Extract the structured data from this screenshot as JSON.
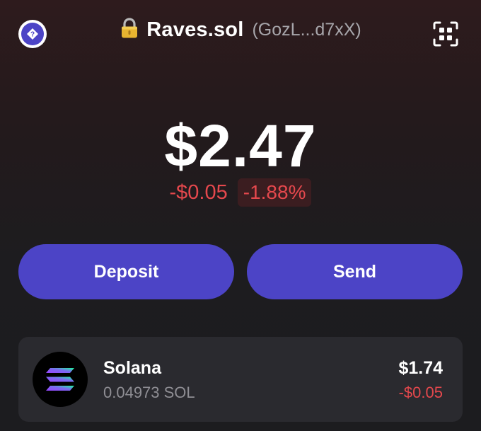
{
  "header": {
    "help_icon": "question-icon",
    "lock_icon": "lock-icon",
    "account_name": "Raves.sol",
    "account_address": "(GozL...d7xX)",
    "scan_icon": "qr-scan-icon"
  },
  "balance": {
    "total": "$2.47",
    "change_abs": "-$0.05",
    "change_pct": "-1.88%"
  },
  "actions": {
    "deposit_label": "Deposit",
    "send_label": "Send"
  },
  "tokens": [
    {
      "icon": "solana-logo-icon",
      "name": "Solana",
      "amount": "0.04973 SOL",
      "value": "$1.74",
      "change": "-$0.05"
    }
  ],
  "colors": {
    "accent": "#4c44c6",
    "negative": "#e5484d",
    "negative_bg": "#3b1d20",
    "card_bg": "#2a2a2f",
    "muted_text": "#a7a6ab"
  }
}
